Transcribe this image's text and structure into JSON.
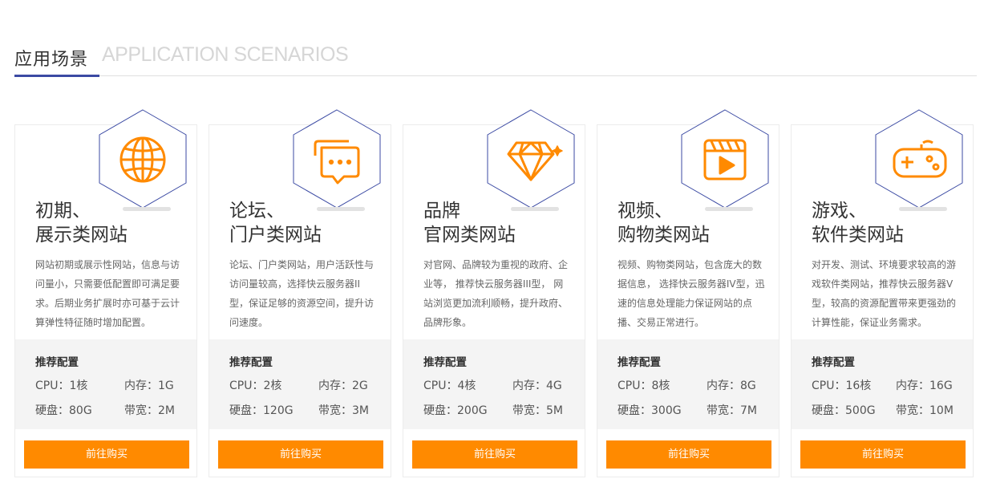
{
  "header": {
    "title": "应用场景",
    "subtitle": "APPLICATION SCENARIOS"
  },
  "colors": {
    "accent": "#ff8a00",
    "hex_border": "#3b4aa3",
    "underline": "#3b4aa3"
  },
  "spec_title": "推荐配置",
  "buy_label": "前往购买",
  "cards": [
    {
      "icon": "globe-icon",
      "title": "初期、\n展示类网站",
      "desc": "网站初期或展示性网站，信息与访问量小，只需要低配置即可满足要求。后期业务扩展时亦可基于云计算弹性特征随时增加配置。",
      "cpu": "CPU：1核",
      "memory": "内存：1G",
      "disk": "硬盘：80G",
      "bandwidth": "带宽：2M"
    },
    {
      "icon": "chat-icon",
      "title": "论坛、\n门户类网站",
      "desc": "论坛、门户类网站，用户活跃性与访问量较高，选择快云服务器II型，保证足够的资源空间，提升访问速度。",
      "cpu": "CPU：2核",
      "memory": "内存：2G",
      "disk": "硬盘：120G",
      "bandwidth": "带宽：3M"
    },
    {
      "icon": "diamond-icon",
      "title": "品牌\n官网类网站",
      "desc": "对官网、品牌较为重视的政府、企业等， 推荐快云服务器III型， 网站浏览更加流利顺畅，提升政府、品牌形象。",
      "cpu": "CPU：4核",
      "memory": "内存：4G",
      "disk": "硬盘：200G",
      "bandwidth": "带宽：5M"
    },
    {
      "icon": "video-icon",
      "title": "视频、\n购物类网站",
      "desc": "视频、购物类网站，包含庞大的数据信息， 选择快云服务器IV型，迅速的信息处理能力保证网站的点播、交易正常进行。",
      "cpu": "CPU：8核",
      "memory": "内存：8G",
      "disk": "硬盘：300G",
      "bandwidth": "带宽：7M"
    },
    {
      "icon": "gamepad-icon",
      "title": "游戏、\n软件类网站",
      "desc": "对开发、测试、环境要求较高的游戏软件类网站，推荐快云服务器V型，较高的资源配置带来更强劲的计算性能，保证业务需求。",
      "cpu": "CPU：16核",
      "memory": "内存：16G",
      "disk": "硬盘：500G",
      "bandwidth": "带宽：10M"
    }
  ]
}
